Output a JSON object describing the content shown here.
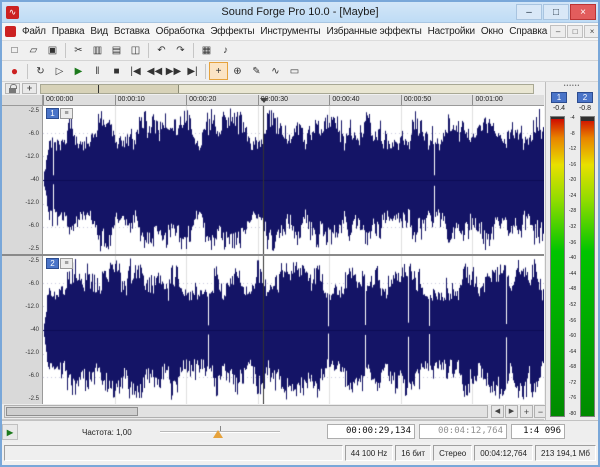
{
  "colors": {
    "titlebar": "#bfdcf5",
    "accent": "#e6a23c",
    "waveform": "#141466",
    "badge": "#4a74c8",
    "record": "#cc2222",
    "play": "#1d7a1d",
    "close": "#e25d5d"
  },
  "window": {
    "title": "Sound Forge Pro 10.0 - [Maybe]",
    "controls": [
      {
        "name": "minimize-button",
        "glyph": "–"
      },
      {
        "name": "maximize-button",
        "glyph": "□"
      },
      {
        "name": "close-button",
        "glyph": "×",
        "style": "close"
      }
    ]
  },
  "menubar": {
    "items": [
      {
        "name": "menu-file",
        "label": "Файл"
      },
      {
        "name": "menu-edit",
        "label": "Правка"
      },
      {
        "name": "menu-view",
        "label": "Вид"
      },
      {
        "name": "menu-insert",
        "label": "Вставка"
      },
      {
        "name": "menu-process",
        "label": "Обработка"
      },
      {
        "name": "menu-effects",
        "label": "Эффекты"
      },
      {
        "name": "menu-tools",
        "label": "Инструменты"
      },
      {
        "name": "menu-favorite-effects",
        "label": "Избранные эффекты"
      },
      {
        "name": "menu-options",
        "label": "Настройки"
      },
      {
        "name": "menu-window",
        "label": "Окно"
      },
      {
        "name": "menu-help",
        "label": "Справка"
      }
    ],
    "controls": [
      {
        "name": "mdi-minimize-button",
        "glyph": "–"
      },
      {
        "name": "mdi-restore-button",
        "glyph": "□"
      },
      {
        "name": "mdi-close-button",
        "glyph": "×"
      }
    ]
  },
  "toolbar": {
    "file": [
      {
        "name": "new-file-button",
        "glyph": "□"
      },
      {
        "name": "open-button",
        "glyph": "▱"
      },
      {
        "name": "save-button",
        "glyph": "▣"
      }
    ],
    "edit": [
      {
        "name": "cut-button",
        "glyph": "✂"
      },
      {
        "name": "copy-button",
        "glyph": "▥"
      },
      {
        "name": "paste-button",
        "glyph": "▤"
      },
      {
        "name": "trim-button",
        "glyph": "◫"
      }
    ],
    "history": [
      {
        "name": "undo-button",
        "glyph": "↶"
      },
      {
        "name": "redo-button",
        "glyph": "↷"
      }
    ],
    "view": [
      {
        "name": "spectrum-button",
        "glyph": "▦"
      },
      {
        "name": "plugin-chainer-button",
        "glyph": "♪"
      }
    ]
  },
  "transport": {
    "record": [
      {
        "name": "record-button",
        "glyph": "●",
        "style": "record"
      }
    ],
    "controls": [
      {
        "name": "loop-playback-button",
        "glyph": "↻"
      },
      {
        "name": "play-all-button",
        "glyph": "▷"
      },
      {
        "name": "play-button",
        "glyph": "▶",
        "style": "play"
      },
      {
        "name": "pause-button",
        "glyph": "‖"
      },
      {
        "name": "stop-button",
        "glyph": "■"
      },
      {
        "name": "go-to-start-button",
        "glyph": "|◀"
      },
      {
        "name": "rewind-button",
        "glyph": "◀◀"
      },
      {
        "name": "forward-button",
        "glyph": "▶▶"
      },
      {
        "name": "go-to-end-button",
        "glyph": "▶|"
      }
    ],
    "tools": [
      {
        "name": "edit-tool-button",
        "glyph": "+",
        "style": "active"
      },
      {
        "name": "magnify-tool-button",
        "glyph": "⊕"
      },
      {
        "name": "pencil-tool-button",
        "glyph": "✎"
      },
      {
        "name": "envelope-tool-button",
        "glyph": "∿"
      },
      {
        "name": "event-tool-button",
        "glyph": "▭"
      }
    ]
  },
  "ruler": {
    "ticks": [
      "00:00:00",
      "00:00:10",
      "00:00:20",
      "00:00:30",
      "00:00:40",
      "00:00:50",
      "00:01:00"
    ]
  },
  "channels": [
    {
      "number": "1",
      "menu_glyph": "≡",
      "db_labels": [
        "-2.5",
        "-6.0",
        "-12.0",
        "-40",
        "-12.0",
        "-6.0",
        "-2.5"
      ]
    },
    {
      "number": "2",
      "menu_glyph": "≡",
      "db_labels": [
        "-2.5",
        "-6.0",
        "-12.0",
        "-40",
        "-12.0",
        "-6.0",
        "-2.5"
      ]
    }
  ],
  "meters": {
    "grip": "••••••",
    "channel_labels": [
      "1",
      "2"
    ],
    "peaks": [
      "-0.4",
      "-0.8"
    ],
    "scale": [
      "-4",
      "-8",
      "-12",
      "-16",
      "-20",
      "-24",
      "-28",
      "-32",
      "-36",
      "-40",
      "-44",
      "-48",
      "-52",
      "-56",
      "-60",
      "-64",
      "-68",
      "-72",
      "-76",
      "-80"
    ]
  },
  "scrollbar": {
    "left_arrow": "◀",
    "right_arrow": "▶",
    "zoom_in": "+",
    "zoom_out": "−"
  },
  "bottombar": {
    "buttons": [
      {
        "name": "record-remote-button",
        "glyph": "●",
        "style": "record"
      },
      {
        "name": "stop-small-button",
        "glyph": "■"
      },
      {
        "name": "play-small-button",
        "glyph": "▶"
      },
      {
        "name": "monitor-button",
        "glyph": "▶",
        "style": "play"
      }
    ],
    "rate_label": "Частота: 1,00",
    "position": "00:00:29,134",
    "length": "00:04:12,764",
    "zoom_ratio": "1:4 096"
  },
  "statusbar": {
    "segments": [
      {
        "name": "status-sample-rate",
        "label": "44 100 Hz"
      },
      {
        "name": "status-bit-depth",
        "label": "16 бит"
      },
      {
        "name": "status-channels",
        "label": "Стерео"
      },
      {
        "name": "status-length",
        "label": "00:04:12,764"
      },
      {
        "name": "status-free-space",
        "label": "213 194,1 Мб"
      }
    ]
  }
}
